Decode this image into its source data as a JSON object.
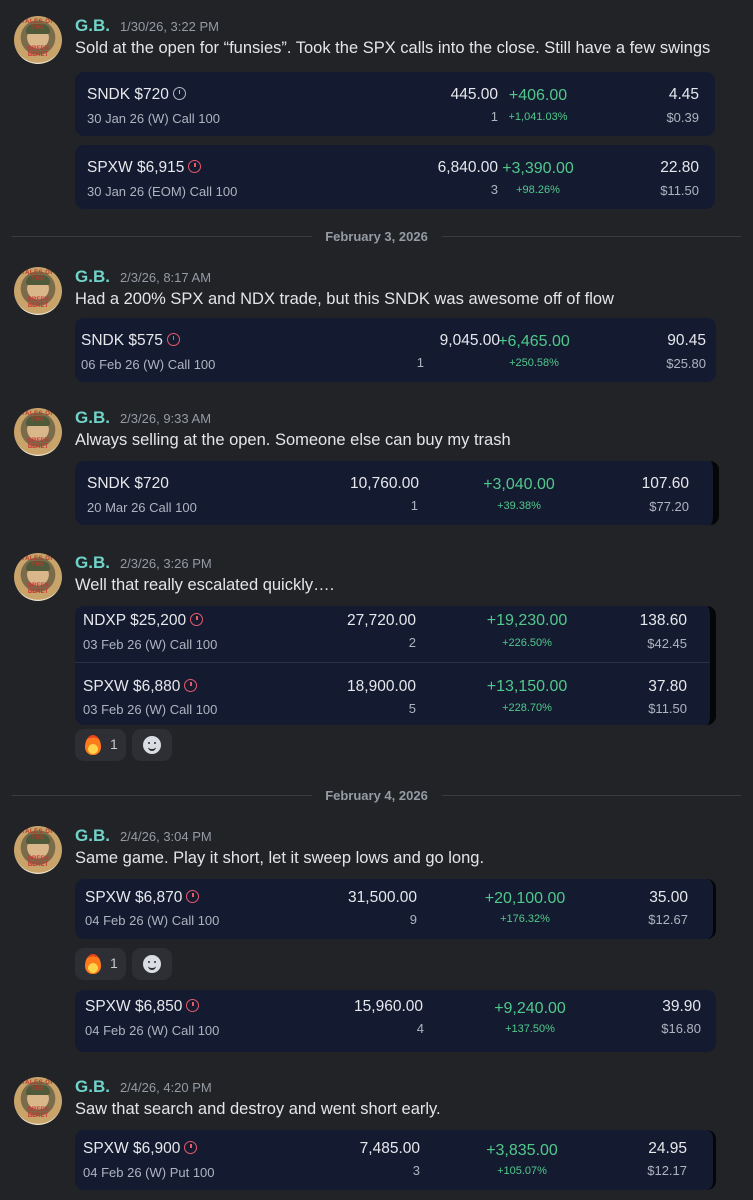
{
  "messages": [
    {
      "author": "G.B.",
      "time": "1/30/26, 3:22 PM",
      "text": "Sold at the open for “funsies”.  Took the SPX calls into the close.  Still have a few swings",
      "cards": [
        {
          "rows": [
            {
              "symbol": "SNDK $720",
              "timer": "grey",
              "desc": "30 Jan 26 (W) Call 100",
              "price": "445.00",
              "qty": "1",
              "pl": "+406.00",
              "pl_pct": "+1,041.03%",
              "last": "4.45",
              "cost": "$0.39"
            }
          ]
        },
        {
          "rows": [
            {
              "symbol": "SPXW $6,915",
              "timer": "red",
              "desc": "30 Jan 26 (EOM) Call 100",
              "price": "6,840.00",
              "qty": "3",
              "pl": "+3,390.00",
              "pl_pct": "+98.26%",
              "last": "22.80",
              "cost": "$11.50"
            }
          ]
        }
      ]
    },
    {
      "author": "G.B.",
      "time": "2/3/26, 8:17 AM",
      "text": "Had a 200% SPX and NDX trade, but this SNDK was awesome off of flow",
      "cards": [
        {
          "rows": [
            {
              "symbol": "SNDK $575",
              "timer": "red",
              "desc": "06 Feb 26 (W) Call 100",
              "price": "9,045.00",
              "qty": "1",
              "pl": "+6,465.00",
              "pl_pct": "+250.58%",
              "last": "90.45",
              "cost": "$25.80"
            }
          ]
        }
      ]
    },
    {
      "author": "G.B.",
      "time": "2/3/26, 9:33 AM",
      "text": "Always selling at the open.  Someone else can buy my trash",
      "cards": [
        {
          "rows": [
            {
              "symbol": "SNDK $720",
              "timer": "",
              "desc": "20 Mar 26 Call 100",
              "price": "10,760.00",
              "qty": "1",
              "pl": "+3,040.00",
              "pl_pct": "+39.38%",
              "last": "107.60",
              "cost": "$77.20"
            }
          ]
        }
      ]
    },
    {
      "author": "G.B.",
      "time": "2/3/26, 3:26 PM",
      "text": "Well that really escalated quickly….",
      "cards": [
        {
          "rows": [
            {
              "symbol": "NDXP $25,200",
              "timer": "red",
              "desc": "03 Feb 26 (W) Call 100",
              "price": "27,720.00",
              "qty": "2",
              "pl": "+19,230.00",
              "pl_pct": "+226.50%",
              "last": "138.60",
              "cost": "$42.45"
            },
            {
              "symbol": "SPXW $6,880",
              "timer": "red",
              "desc": "03 Feb 26 (W) Call 100",
              "price": "18,900.00",
              "qty": "5",
              "pl": "+13,150.00",
              "pl_pct": "+228.70%",
              "last": "37.80",
              "cost": "$11.50"
            }
          ]
        }
      ],
      "reaction_count": "1"
    },
    {
      "author": "G.B.",
      "time": "2/4/26, 3:04 PM",
      "text": "Same game. Play it short, let it sweep lows and go long.",
      "cards": [
        {
          "rows": [
            {
              "symbol": "SPXW $6,870",
              "timer": "red",
              "desc": "04 Feb 26 (W) Call 100",
              "price": "31,500.00",
              "qty": "9",
              "pl": "+20,100.00",
              "pl_pct": "+176.32%",
              "last": "35.00",
              "cost": "$12.67"
            }
          ]
        },
        {
          "rows": [
            {
              "symbol": "SPXW $6,850",
              "timer": "red",
              "desc": "04 Feb 26 (W) Call 100",
              "price": "15,960.00",
              "qty": "4",
              "pl": "+9,240.00",
              "pl_pct": "+137.50%",
              "last": "39.90",
              "cost": "$16.80"
            }
          ]
        }
      ],
      "reaction_count": "1"
    },
    {
      "author": "G.B.",
      "time": "2/4/26, 4:20 PM",
      "text": "Saw that search and destroy and went short early.",
      "cards": [
        {
          "rows": [
            {
              "symbol": "SPXW $6,900",
              "timer": "red",
              "desc": "04 Feb 26 (W) Put 100",
              "price": "7,485.00",
              "qty": "3",
              "pl": "+3,835.00",
              "pl_pct": "+105.07%",
              "last": "24.95",
              "cost": "$12.17"
            }
          ]
        }
      ]
    }
  ],
  "dividers": [
    "February 3, 2026",
    "February 4, 2026"
  ],
  "avatar_text": [
    "TALES OF THE",
    "GREEN BERET"
  ],
  "colors": {
    "author": "#6fd3c8",
    "gain": "#51c88b",
    "timer": "#e8596a",
    "card": "#141b30",
    "background": "#222327"
  }
}
